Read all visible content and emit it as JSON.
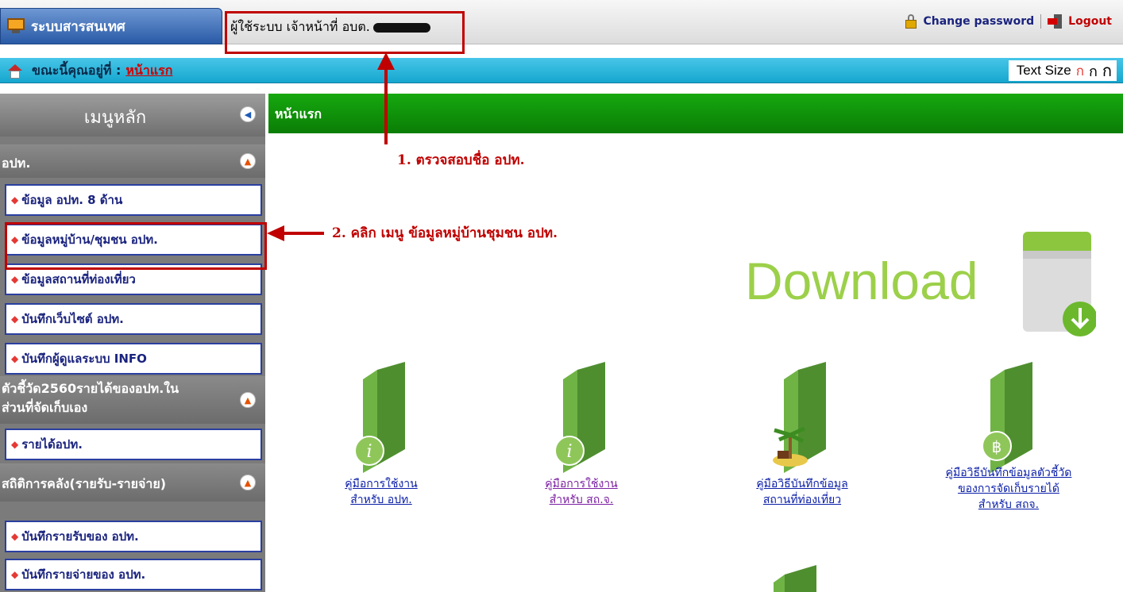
{
  "topbar": {
    "system_tab": "ระบบสารสนเทศ",
    "user_label": "ผู้ใช้ระบบ เจ้าหน้าที่ อบต.",
    "change_password": "Change password",
    "logout": "Logout"
  },
  "breadcrumb": {
    "prefix": "ขณะนี้คุณอยู่ที่ :",
    "current": "หน้าแรก"
  },
  "text_size": {
    "label": "Text Size",
    "options": [
      "ก",
      "ก",
      "ก"
    ]
  },
  "sidebar": {
    "title": "เมนูหลัก",
    "groups": [
      {
        "label": "อปท."
      },
      {
        "label_line1": "ตัวชี้วัด2560รายได้ของอปท.ใน",
        "label_line2": "ส่วนที่จัดเก็บเอง"
      },
      {
        "label": "สถิติการคลัง(รายรับ-รายจ่าย)"
      }
    ],
    "items": [
      "ข้อมูล อปท. 8 ด้าน",
      "ข้อมูลหมู่บ้าน/ชุมชน อปท.",
      "ข้อมูลสถานที่ท่องเที่ยว",
      "บันทึกเว็บไซต์ อปท.",
      "บันทึกผู้ดูแลระบบ INFO",
      "รายได้อปท.",
      "บันทึกรายรับของ อปท.",
      "บันทึกรายจ่ายของ อปท."
    ]
  },
  "content": {
    "title": "หน้าแรก",
    "download_text": "Download",
    "manuals": [
      {
        "line1": "คู่มือการใช้งาน",
        "line2": "สำหรับ อปท.",
        "icon": "info-book-icon"
      },
      {
        "line1": "คู่มือการใช้งาน",
        "line2": "สำหรับ สถ.จ.",
        "icon": "info-book-icon"
      },
      {
        "line1": "คู่มือวิธีบันทึกข้อมูล",
        "line2": "สถานที่ท่องเที่ยว",
        "icon": "travel-book-icon"
      },
      {
        "line1": "คู่มือวิธีบันทึกข้อมูลตัวชี้วัด",
        "line2": "ของการจัดเก็บรายได้",
        "line3": "สำหรับ สถจ.",
        "icon": "baht-book-icon"
      }
    ]
  },
  "annotations": {
    "step1": "1. ตรวจสอบชื่อ อปท.",
    "step2": "2. คลิก เมนู ข้อมูลหมู่บ้านชุมชน อปท."
  },
  "colors": {
    "accent_red": "#c00000",
    "header_green": "#0a7d05",
    "breadcrumb_cyan": "#16a6cf",
    "book_green": "#5aa33a"
  }
}
